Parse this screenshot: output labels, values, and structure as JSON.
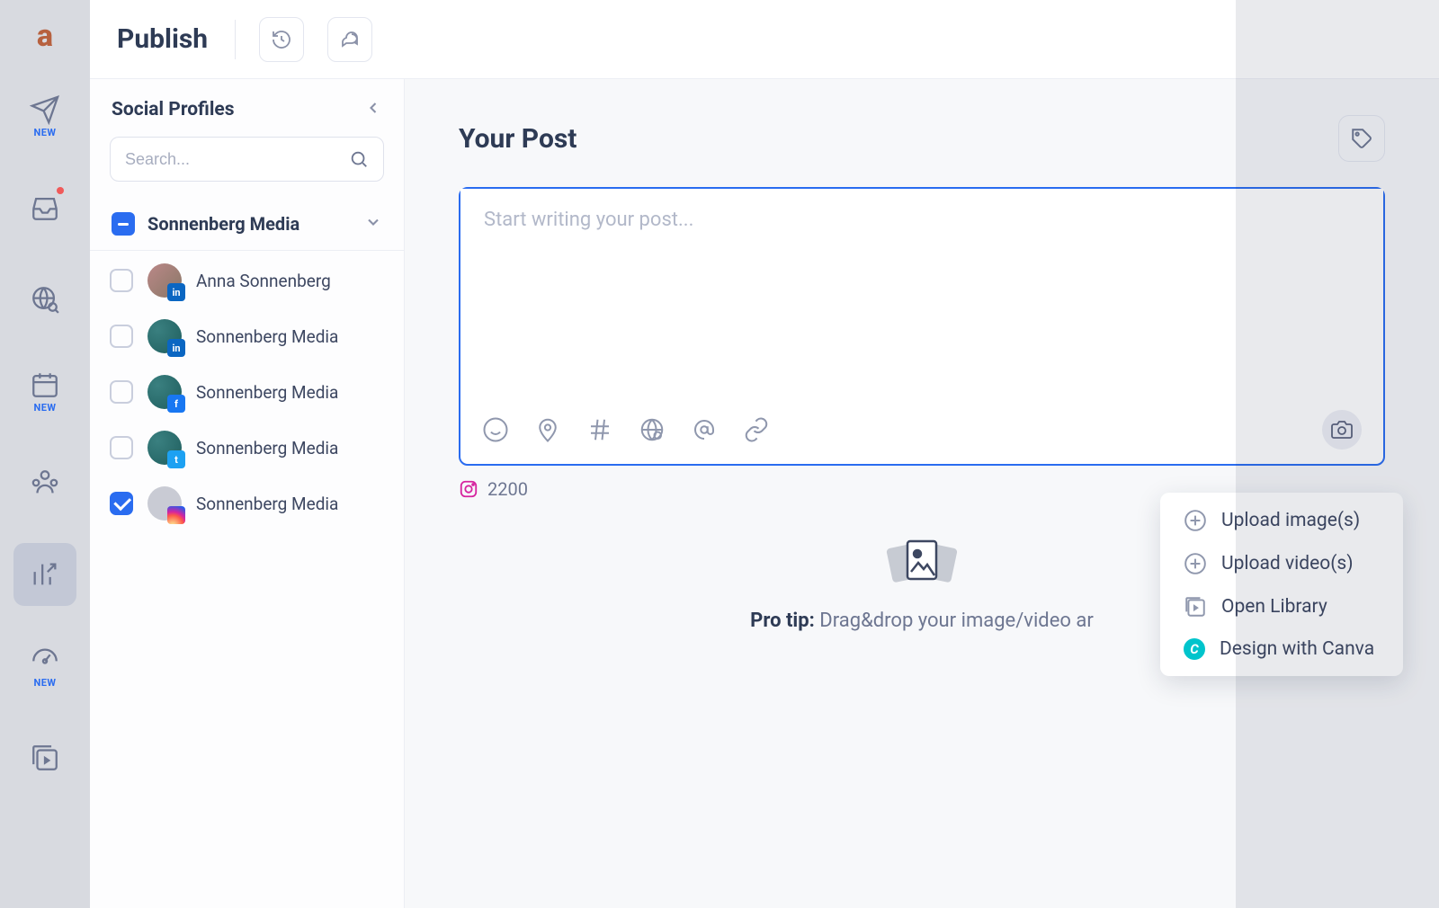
{
  "colors": {
    "accent": "#2a6cf0"
  },
  "nav": {
    "new_label": "NEW"
  },
  "topbar": {
    "title": "Publish"
  },
  "sidebar": {
    "title": "Social Profiles",
    "search_placeholder": "Search...",
    "group_name": "Sonnenberg Media",
    "profiles": [
      {
        "label": "Anna Sonnenberg",
        "network": "linkedin",
        "checked": false
      },
      {
        "label": "Sonnenberg Media",
        "network": "linkedin",
        "checked": false
      },
      {
        "label": "Sonnenberg Media",
        "network": "facebook",
        "checked": false
      },
      {
        "label": "Sonnenberg Media",
        "network": "twitter",
        "checked": false
      },
      {
        "label": "Sonnenberg Media",
        "network": "instagram",
        "checked": true
      }
    ]
  },
  "editor": {
    "title": "Your Post",
    "placeholder": "Start writing your post...",
    "char_count": "2200",
    "protip_prefix": "Pro tip:",
    "protip_text": "Drag&drop your image/video ar"
  },
  "media_menu": {
    "upload_images": "Upload image(s)",
    "upload_videos": "Upload video(s)",
    "open_library": "Open Library",
    "design_canva": "Design with Canva"
  }
}
